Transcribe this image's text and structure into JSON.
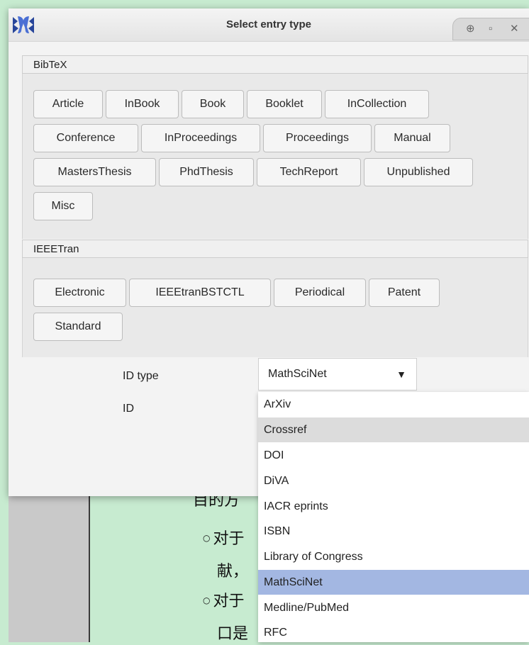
{
  "window": {
    "title": "Select entry type",
    "app_icon": "jabref-logo-icon",
    "controls": [
      "restore-icon",
      "maximize-icon",
      "close-icon"
    ]
  },
  "sections": [
    {
      "title": "BibTeX",
      "buttons": [
        "Article",
        "InBook",
        "Book",
        "Booklet",
        "InCollection",
        "Conference",
        "InProceedings",
        "Proceedings",
        "Manual",
        "MastersThesis",
        "PhdThesis",
        "TechReport",
        "Unpublished",
        "Misc"
      ]
    },
    {
      "title": "IEEETran",
      "buttons": [
        "Electronic",
        "IEEEtranBSTCTL",
        "Periodical",
        "Patent",
        "Standard"
      ]
    }
  ],
  "form": {
    "id_type_label": "ID type",
    "id_type_value": "MathSciNet",
    "id_label": "ID"
  },
  "dropdown": {
    "options": [
      "ArXiv",
      "Crossref",
      "DOI",
      "DiVA",
      "IACR eprints",
      "ISBN",
      "Library of Congress",
      "MathSciNet",
      "Medline/PubMed",
      "RFC"
    ],
    "hovered": "Crossref",
    "selected": "MathSciNet"
  },
  "background_doc": {
    "lines": [
      "目的方",
      "对于",
      "献，",
      "对于",
      "口是"
    ]
  },
  "colors": {
    "background": "#c7ebd0",
    "selected_option": "#a3b7e2",
    "hovered_option": "#dcdcdc"
  }
}
